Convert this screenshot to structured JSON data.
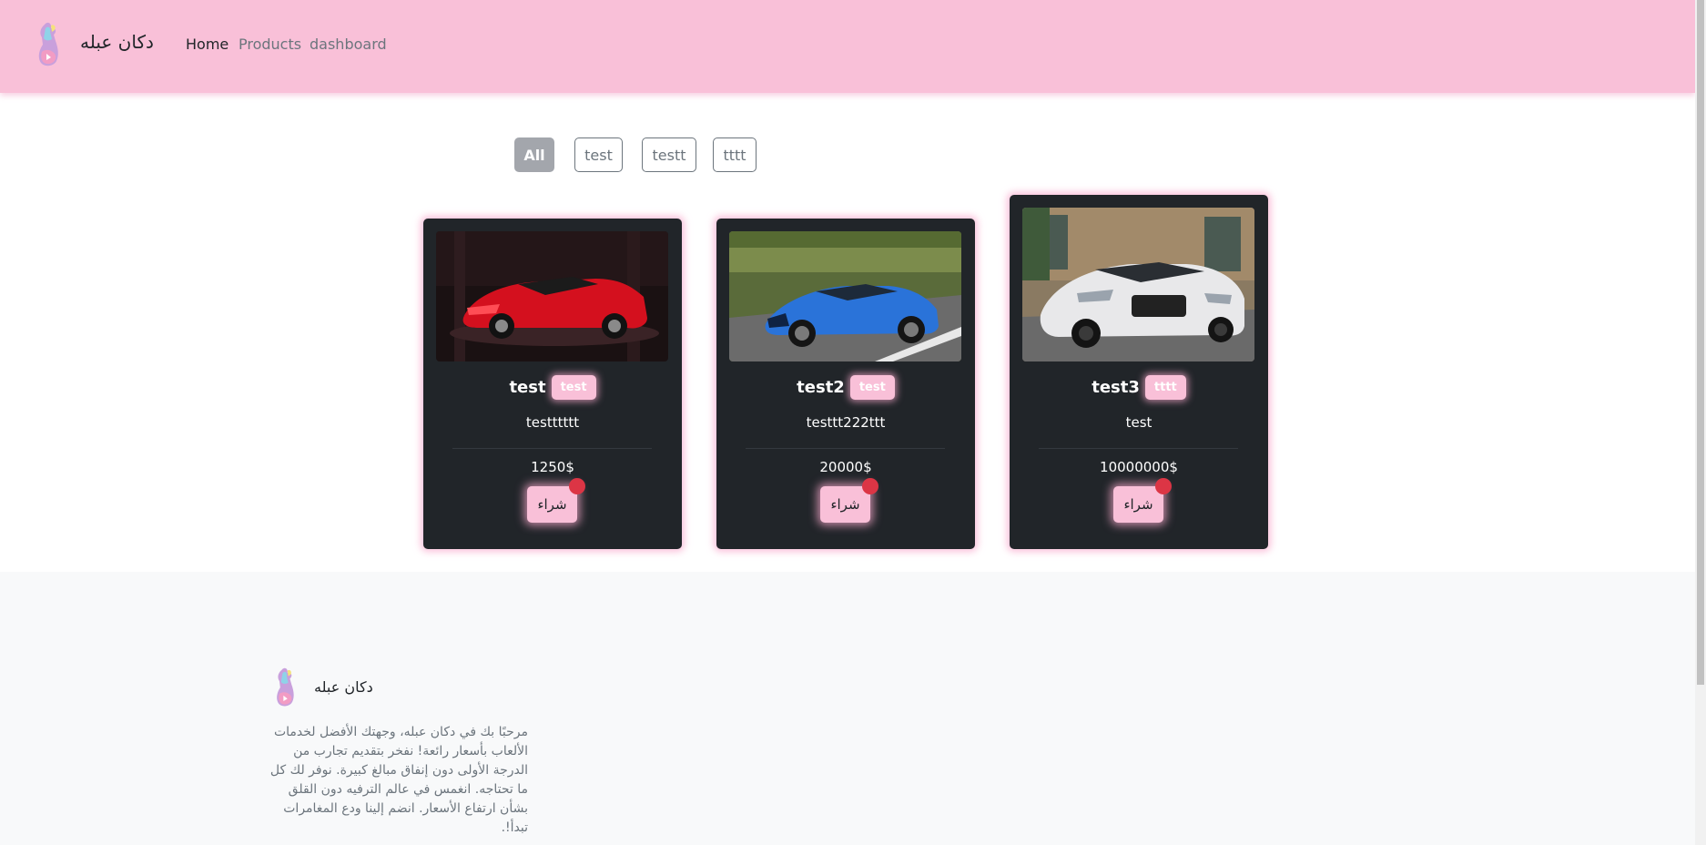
{
  "navbar": {
    "brand": "دكان عبله",
    "links": [
      "Home",
      "Products",
      "dashboard"
    ]
  },
  "filters": [
    "All",
    "test",
    "testt",
    "tttt"
  ],
  "products": [
    {
      "name": "test",
      "tag": "test",
      "description": "testttttt",
      "price": "1250$",
      "buy_label": "شراء",
      "image": "red sports car"
    },
    {
      "name": "test2",
      "tag": "test",
      "description": "testtt222ttt",
      "price": "20000$",
      "buy_label": "شراء",
      "image": "blue sports car"
    },
    {
      "name": "test3",
      "tag": "tttt",
      "description": "test",
      "price": "10000000$",
      "buy_label": "شراء",
      "image": "white sedan"
    }
  ],
  "footer": {
    "brand": "دكان عبله",
    "text": "مرحبًا بك في دكان عبله، وجهتك الأفضل لخدمات الألعاب بأسعار رائعة! نفخر بتقديم تجارب من الدرجة الأولى دون إنفاق مبالغ كبيرة. نوفر لك كل ما تحتاجه. انغمس في عالم الترفيه دون القلق بشأن ارتفاع الأسعار. انضم إلينا ودع المغامرات تبدأ!."
  },
  "colors": {
    "navbar": "#f9c0d8",
    "card": "#212529",
    "accent_pink": "#f9c0d8",
    "badge": "#dc3545"
  }
}
